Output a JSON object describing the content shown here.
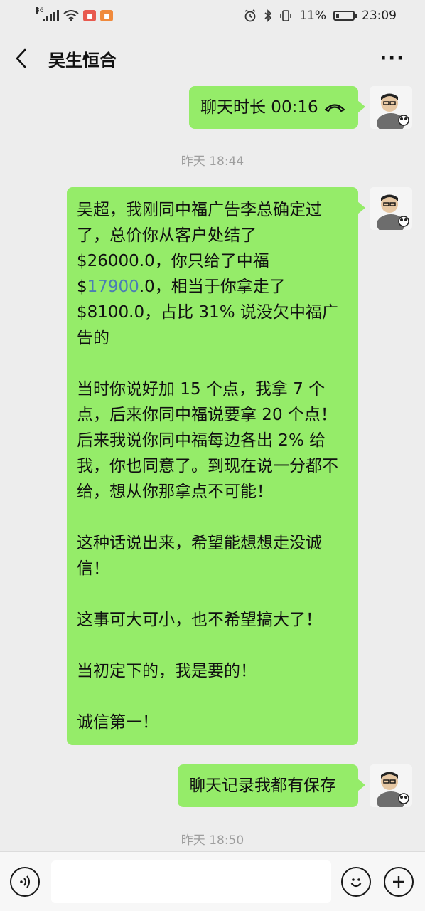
{
  "status_bar": {
    "network": "36",
    "battery_percent": "11%",
    "time": "23:09",
    "icons": [
      "signal-icon",
      "wifi-icon",
      "app-notification-icon",
      "alarm-icon",
      "bluetooth-icon",
      "vibrate-icon",
      "battery-icon"
    ]
  },
  "header": {
    "title": "吴生恒合",
    "more_label": "···"
  },
  "messages": [
    {
      "type": "call",
      "text": "聊天时长 00:16"
    },
    {
      "type": "timestamp",
      "text": "昨天 18:44"
    },
    {
      "type": "long",
      "paragraphs": [
        {
          "parts": [
            "吴超，我刚同中福广告李总确定过了，总价你从客户处结了 $26000.0，你只给了中福 $",
            "17900",
            ".0，相当于你拿走了 $8100.0，占比 31% 说没欠中福广告的"
          ]
        },
        {
          "text": "当时你说好加 15 个点，我拿 7 个点，后来你同中福说要拿 20 个点！后来我说你同中福每边各出 2% 给我，你也同意了。到现在说一分都不给，想从你那拿点不可能！"
        },
        {
          "text": "这种话说出来，希望能想想走没诚信！"
        },
        {
          "text": "这事可大可小，也不希望搞大了！"
        },
        {
          "text": "当初定下的，我是要的！"
        },
        {
          "text": "诚信第一！"
        }
      ]
    },
    {
      "type": "text",
      "text": "聊天记录我都有保存"
    },
    {
      "type": "timestamp",
      "text": "昨天 18:50"
    }
  ],
  "input_bar": {
    "placeholder": "",
    "icons": [
      "voice-icon",
      "emoji-icon",
      "plus-icon"
    ]
  },
  "colors": {
    "bubble": "#95ec69",
    "background": "#ededed",
    "link": "#4a7db5"
  }
}
